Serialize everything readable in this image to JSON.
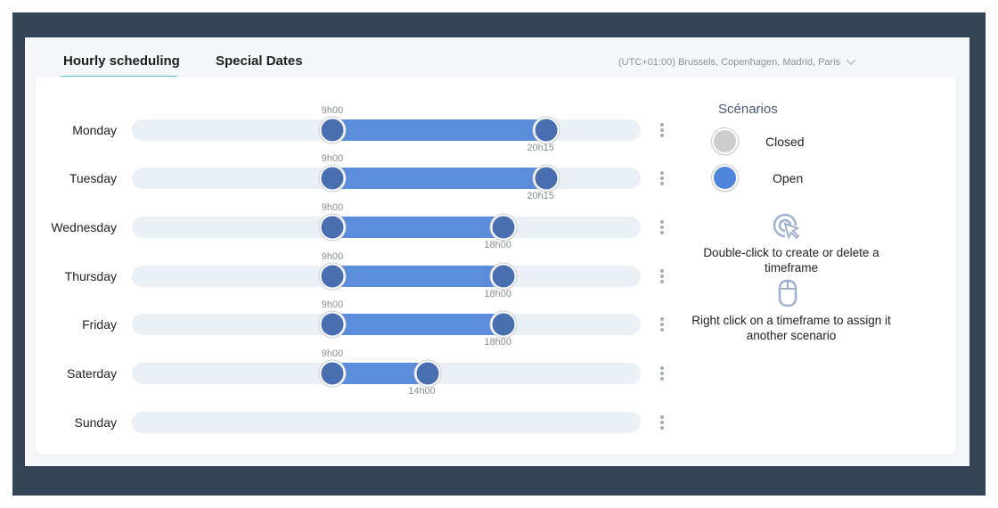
{
  "tabs": [
    {
      "label": "Hourly scheduling",
      "active": true
    },
    {
      "label": "Special Dates",
      "active": false
    }
  ],
  "timezone": {
    "value": "(UTC+01:00) Brussels, Copenhagen, Madrid, Paris",
    "icon": "chevron-down-icon"
  },
  "colors": {
    "accent": "#5bc4c6",
    "open": "#5b8ddb",
    "handle": "#4a6fb1",
    "closed": "#cccccc",
    "track": "#ebeff6"
  },
  "days": [
    {
      "name": "Monday",
      "start": "9h00",
      "end": "20h15"
    },
    {
      "name": "Tuesday",
      "start": "9h00",
      "end": "20h15"
    },
    {
      "name": "Wednesday",
      "start": "9h00",
      "end": "18h00"
    },
    {
      "name": "Thursday",
      "start": "9h00",
      "end": "18h00"
    },
    {
      "name": "Friday",
      "start": "9h00",
      "end": "18h00"
    },
    {
      "name": "Saterday",
      "start": "9h00",
      "end": "14h00"
    },
    {
      "name": "Sunday",
      "start": null,
      "end": null
    }
  ],
  "scenarios": {
    "title": "Scénarios",
    "items": [
      {
        "label": "Closed",
        "color": "#cccccc"
      },
      {
        "label": "Open",
        "color": "#4f86db"
      }
    ]
  },
  "hints": [
    {
      "icon": "double-click-icon",
      "text": "Double-click to create or delete a timeframe"
    },
    {
      "icon": "mouse-icon",
      "text": "Right click on a timeframe to assign it another scenario"
    }
  ]
}
